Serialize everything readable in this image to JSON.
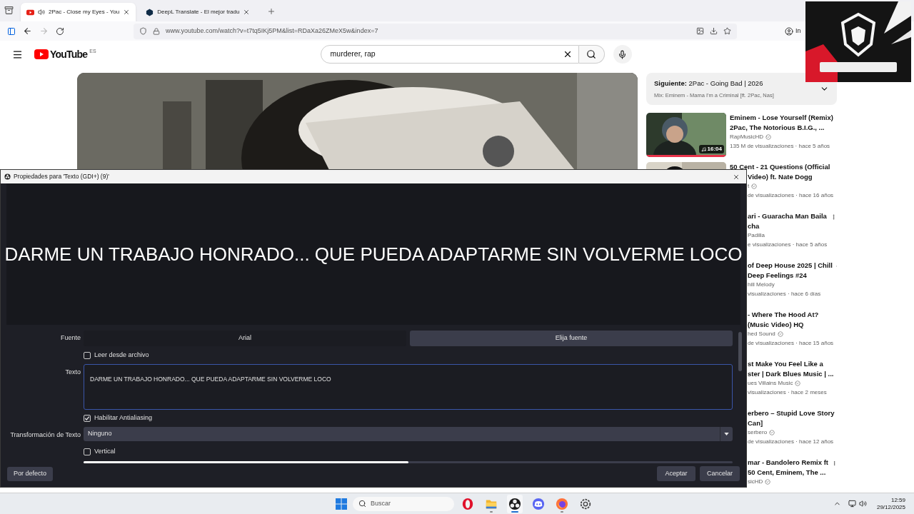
{
  "browser": {
    "tabs": [
      {
        "title": "2Pac - Close my Eyes - You",
        "selected": true,
        "audio": true
      },
      {
        "title": "DeepL Translate - El mejor tradu",
        "selected": false,
        "audio": false
      }
    ],
    "url": "www.youtube.com/watch?v=t7tq5IKj5PM&list=RDaXa26ZMeX5w&index=7",
    "profile_label": "In"
  },
  "youtube": {
    "logo": "YouTube",
    "region": "ES",
    "search": {
      "value": "murderer, rap"
    },
    "up_next": {
      "title": "**Siguiente:** 2Pac - Going Bad | 2026",
      "mix": "Mix: Eminem - Mama I'm a Criminal [ft. 2Pac, Nas]"
    },
    "videos": [
      {
        "title_lines": [
          "Eminem - Lose Yourself (Remix)",
          "2Pac, The Notorious B.I.G., ..."
        ],
        "channel": "RapMusicHD",
        "verified": true,
        "stats": "135 M de visualizaciones · hace 5 años",
        "duration": "16:04"
      },
      {
        "title_lines": [
          "50 Cent - 21 Questions (Official",
          "Video) ft. Nate Dogg"
        ],
        "channel": "t",
        "verified": true,
        "stats": "de visualizaciones · hace 16 años"
      },
      {
        "title_lines": [
          "ari - Guaracha Man  Baila",
          "cha"
        ],
        "channel": "Padilla",
        "verified": false,
        "stats": "e visualizaciones · hace 5 años"
      },
      {
        "title_lines": [
          "of Deep House 2025 | Chill",
          "Deep Feelings #24"
        ],
        "channel": "hill Melody",
        "verified": false,
        "stats": "visualizaciones · hace 6 días"
      },
      {
        "title_lines": [
          "- Where The Hood At?",
          "(Music Video) HQ"
        ],
        "channel": "hed Sound",
        "verified": true,
        "stats": "de visualizaciones · hace 15 años"
      },
      {
        "title_lines": [
          "st Make You Feel Like a",
          "ster | Dark Blues Music | ..."
        ],
        "channel": "ues Villains Music",
        "verified": true,
        "stats": "visualizaciones · hace 2 meses"
      },
      {
        "title_lines": [
          "erbero – Stupid Love Story",
          "Can]"
        ],
        "channel": "serbero",
        "verified": true,
        "stats": "de visualizaciones · hace 12 años"
      },
      {
        "title_lines": [
          "mar - Bandolero Remix ft",
          "50 Cent, Eminem, The ..."
        ],
        "channel": "sicHD",
        "verified": true
      }
    ]
  },
  "dialog": {
    "title": "Propiedades para 'Texto (GDI+) (9)'",
    "preview_text": "DARME UN TRABAJO HONRADO... QUE PUEDA ADAPTARME SIN VOLVERME LOCO",
    "font": {
      "label": "Fuente",
      "value": "Arial",
      "button": "Elija fuente"
    },
    "read_from_file": {
      "label": "Leer desde archivo",
      "checked": false
    },
    "text": {
      "label": "Texto",
      "value": "DARME UN TRABAJO HONRADO... QUE PUEDA ADAPTARME SIN VOLVERME LOCO"
    },
    "antialiasing": {
      "label": "Habilitar Antialiasing",
      "checked": true
    },
    "transform": {
      "label": "Transformación de Texto",
      "value": "Ninguno"
    },
    "vertical": {
      "label": "Vertical",
      "checked": false
    },
    "slider": {
      "level": 0.5
    },
    "buttons": {
      "defaults": "Por defecto",
      "ok": "Aceptar",
      "cancel": "Cancelar"
    }
  },
  "taskbar": {
    "search_placeholder": "Buscar",
    "apps": [
      {
        "kind": "opera",
        "running": false,
        "active": false
      },
      {
        "kind": "files",
        "running": true,
        "active": false
      },
      {
        "kind": "obs",
        "running": true,
        "active": true
      },
      {
        "kind": "discord",
        "running": false,
        "active": false
      },
      {
        "kind": "firefox",
        "running": true,
        "active": false
      },
      {
        "kind": "gear",
        "running": false,
        "active": false
      }
    ],
    "time": "12:59",
    "date": "29/12/2025"
  }
}
